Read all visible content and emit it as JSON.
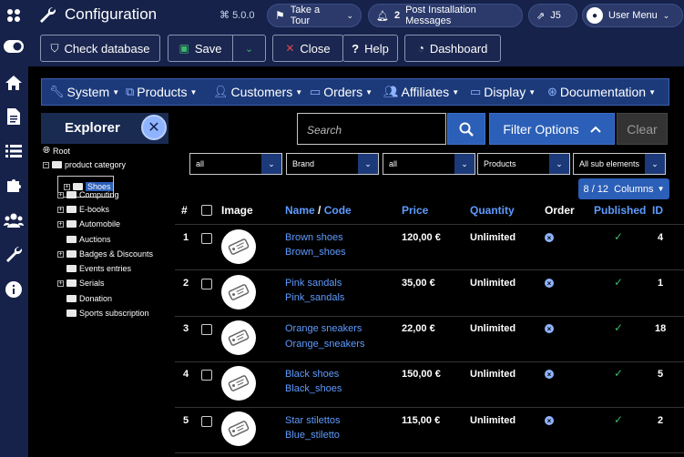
{
  "header": {
    "title": "Configuration",
    "version": "5.0.0",
    "take_tour": "Take a Tour",
    "notifications_count": "2",
    "post_install": "Post Installation Messages",
    "j5": "J5",
    "user_menu": "User Menu"
  },
  "toolbar": {
    "check_db": "Check database",
    "save": "Save",
    "close": "Close",
    "help": "Help",
    "dashboard": "Dashboard"
  },
  "menu": [
    "System",
    "Products",
    "Customers",
    "Orders",
    "Affiliates",
    "Display",
    "Documentation"
  ],
  "explorer": {
    "title": "Explorer",
    "root": "Root",
    "category": "product category",
    "items": [
      "Shoes",
      "Computing",
      "E-books",
      "Automobile",
      "Auctions",
      "Badges & Discounts",
      "Events entries",
      "Serials",
      "Donation",
      "Sports subscription"
    ]
  },
  "search": {
    "placeholder": "Search"
  },
  "filter_options": "Filter Options",
  "clear": "Clear",
  "filters": [
    "all",
    "Brand",
    "all",
    "Products",
    "All sub elements"
  ],
  "columns_toggle": "8 / 12  Columns",
  "table": {
    "headers": {
      "hash": "#",
      "image": "Image",
      "name": "Name",
      "slash": " / ",
      "code": "Code",
      "price": "Price",
      "quantity": "Quantity",
      "order": "Order",
      "published": "Published",
      "id": "ID"
    },
    "rows": [
      {
        "n": "1",
        "name": "Brown shoes",
        "code": "Brown_shoes",
        "price": "120,00 €",
        "qty": "Unlimited",
        "id": "4"
      },
      {
        "n": "2",
        "name": "Pink sandals",
        "code": "Pink_sandals",
        "price": "35,00 €",
        "qty": "Unlimited",
        "id": "1"
      },
      {
        "n": "3",
        "name": "Orange sneakers",
        "code": "Orange_sneakers",
        "price": "22,00 €",
        "qty": "Unlimited",
        "id": "18"
      },
      {
        "n": "4",
        "name": "Black shoes",
        "code": "Black_shoes",
        "price": "150,00 €",
        "qty": "Unlimited",
        "id": "5"
      },
      {
        "n": "5",
        "name": "Star stilettos",
        "code": "Blue_stiletto",
        "price": "115,00 €",
        "qty": "Unlimited",
        "id": "2"
      }
    ]
  }
}
